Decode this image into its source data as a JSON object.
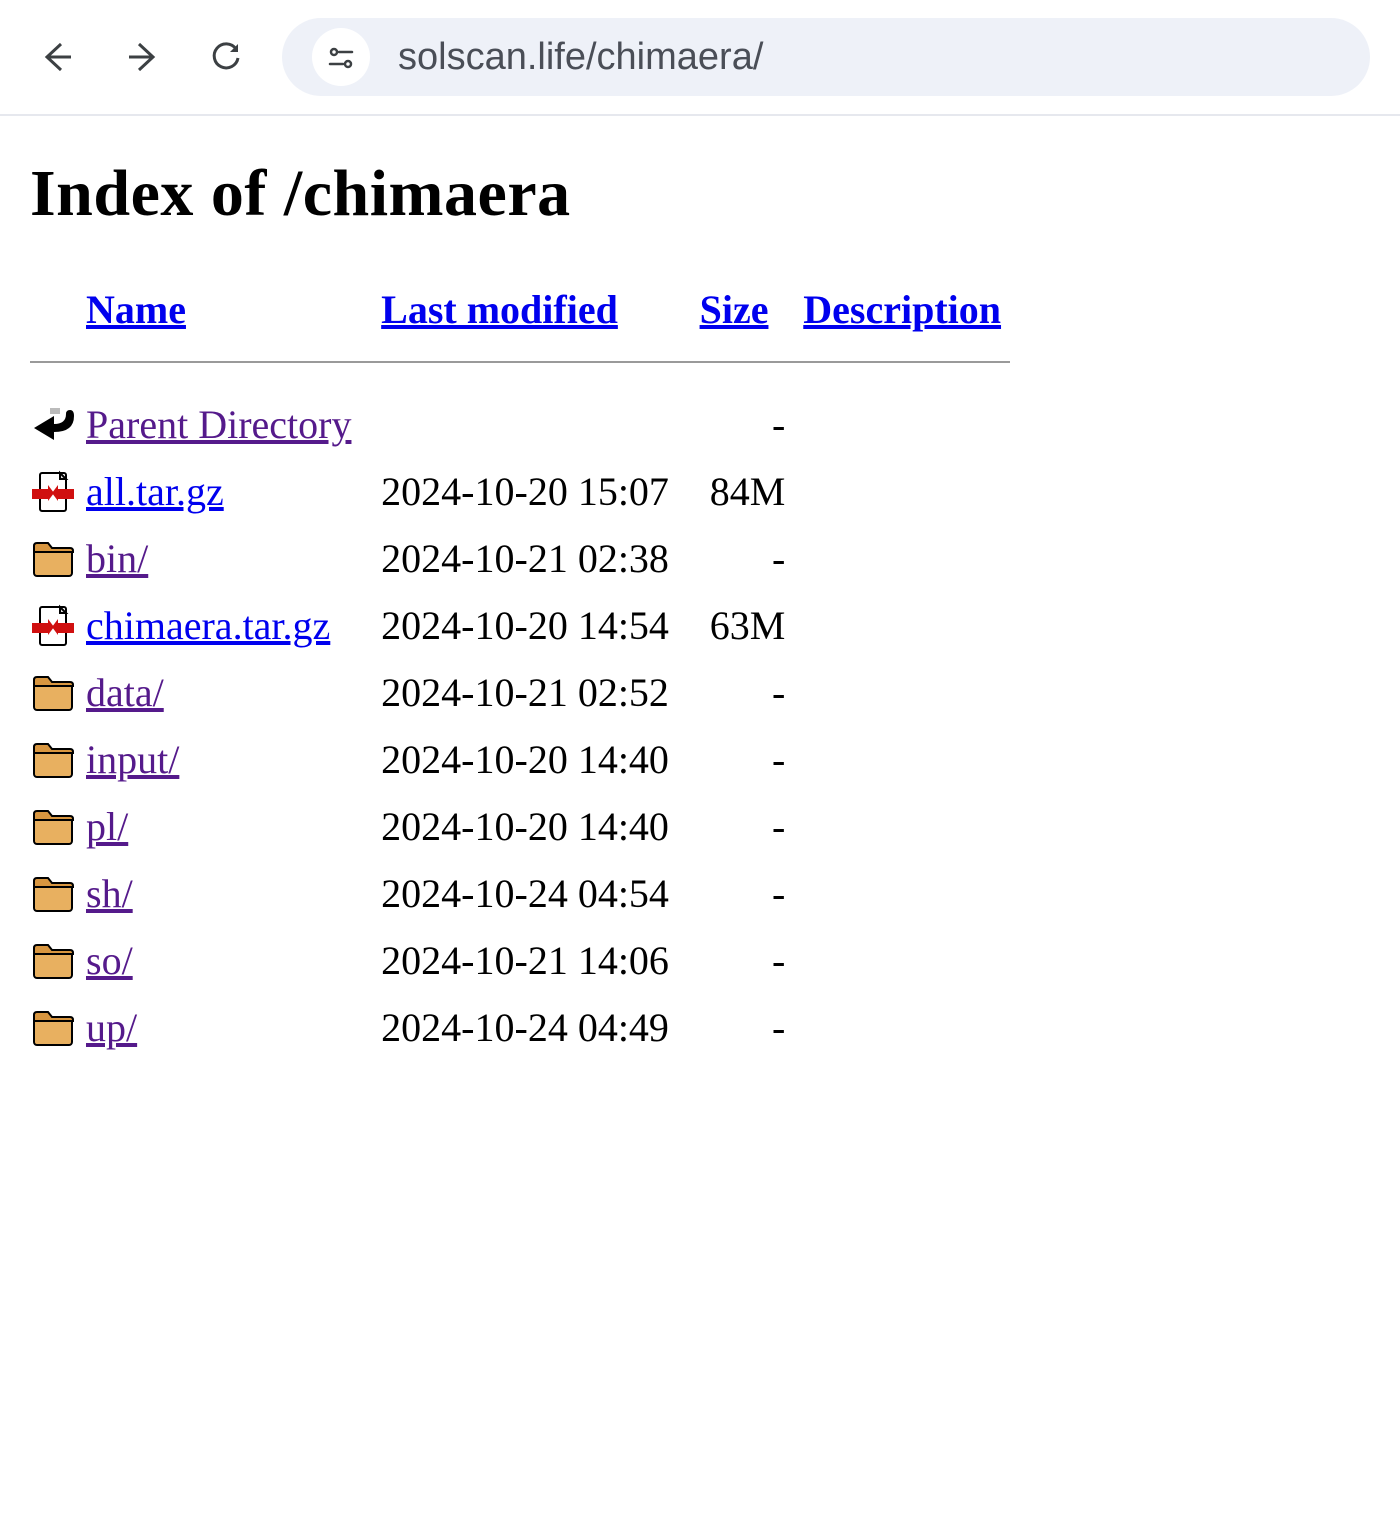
{
  "browser": {
    "url": "solscan.life/chimaera/"
  },
  "page": {
    "title": "Index of /chimaera",
    "columns": {
      "name": "Name",
      "last_modified": "Last modified",
      "size": "Size",
      "description": "Description"
    },
    "entries": [
      {
        "icon": "back",
        "name": "Parent Directory",
        "modified": "",
        "size": "-",
        "visited": true
      },
      {
        "icon": "archive",
        "name": "all.tar.gz",
        "modified": "2024-10-20 15:07",
        "size": "84M",
        "visited": false
      },
      {
        "icon": "folder",
        "name": "bin/",
        "modified": "2024-10-21 02:38",
        "size": "-",
        "visited": true
      },
      {
        "icon": "archive",
        "name": "chimaera.tar.gz",
        "modified": "2024-10-20 14:54",
        "size": "63M",
        "visited": false
      },
      {
        "icon": "folder",
        "name": "data/",
        "modified": "2024-10-21 02:52",
        "size": "-",
        "visited": true
      },
      {
        "icon": "folder",
        "name": "input/",
        "modified": "2024-10-20 14:40",
        "size": "-",
        "visited": true
      },
      {
        "icon": "folder",
        "name": "pl/",
        "modified": "2024-10-20 14:40",
        "size": "-",
        "visited": true
      },
      {
        "icon": "folder",
        "name": "sh/",
        "modified": "2024-10-24 04:54",
        "size": "-",
        "visited": true
      },
      {
        "icon": "folder",
        "name": "so/",
        "modified": "2024-10-21 14:06",
        "size": "-",
        "visited": true
      },
      {
        "icon": "folder",
        "name": "up/",
        "modified": "2024-10-24 04:49",
        "size": "-",
        "visited": true
      }
    ]
  }
}
